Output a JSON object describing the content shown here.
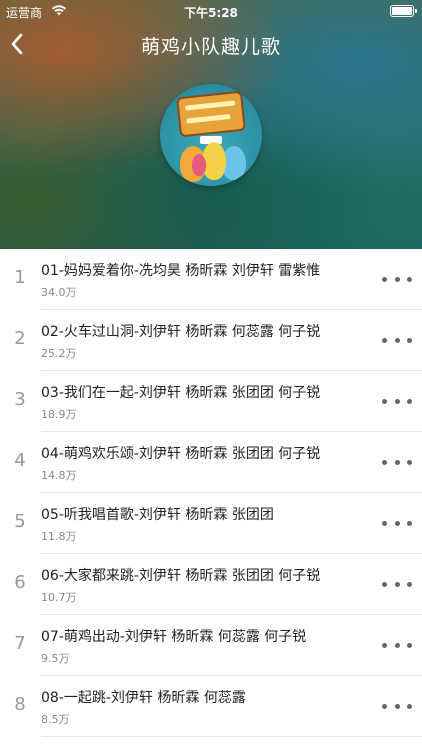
{
  "status_bar": {
    "carrier": "运营商",
    "time": "下午5:28"
  },
  "nav": {
    "title": "萌鸡小队趣儿歌",
    "back_icon": "chevron-left-icon"
  },
  "colors": {
    "row_text": "#222222",
    "count_text": "#888888",
    "index_text": "#999999",
    "more_dots": "#666666"
  },
  "songs": [
    {
      "index": "1",
      "title": "01-妈妈爱着你-冼均昊 杨昕霖 刘伊轩 雷紫惟",
      "count": "34.0万"
    },
    {
      "index": "2",
      "title": "02-火车过山洞-刘伊轩 杨昕霖 何蕊露 何子锐",
      "count": "25.2万"
    },
    {
      "index": "3",
      "title": "03-我们在一起-刘伊轩 杨昕霖 张团团 何子锐",
      "count": "18.9万"
    },
    {
      "index": "4",
      "title": "04-萌鸡欢乐颂-刘伊轩 杨昕霖 张团团 何子锐",
      "count": "14.8万"
    },
    {
      "index": "5",
      "title": "05-听我唱首歌-刘伊轩 杨昕霖 张团团",
      "count": "11.8万"
    },
    {
      "index": "6",
      "title": "06-大家都来跳-刘伊轩 杨昕霖 张团团 何子锐",
      "count": "10.7万"
    },
    {
      "index": "7",
      "title": "07-萌鸡出动-刘伊轩 杨昕霖 何蕊露 何子锐",
      "count": "9.5万"
    },
    {
      "index": "8",
      "title": "08-一起跳-刘伊轩 杨昕霖 何蕊露",
      "count": "8.5万"
    }
  ]
}
